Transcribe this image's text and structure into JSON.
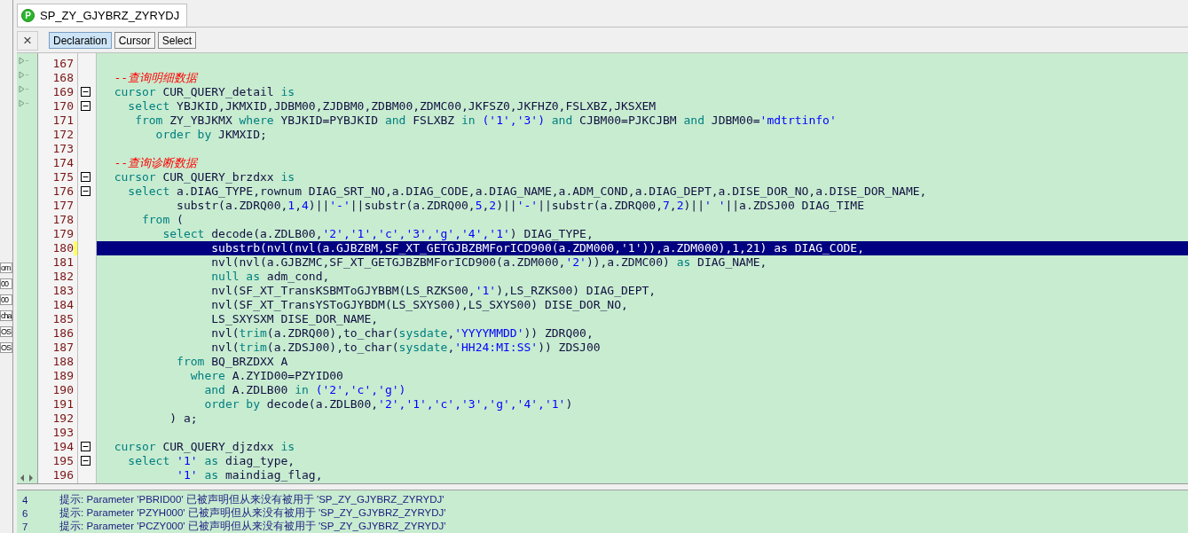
{
  "left_panel": {
    "items": [
      "om",
      "00",
      "00",
      "cha",
      "OS",
      "OS"
    ]
  },
  "tab": {
    "title": "SP_ZY_GJYBRZ_ZYRYDJ",
    "icon_letter": "P",
    "selected": true
  },
  "toolbar": {
    "close": "×",
    "buttons": [
      {
        "label": "Declaration",
        "selected": true
      },
      {
        "label": "Cursor",
        "selected": false
      },
      {
        "label": "Select",
        "selected": false
      }
    ]
  },
  "editor": {
    "lines": [
      {
        "number": "167",
        "fold": false,
        "selected": false
      },
      {
        "number": "168",
        "fold": false,
        "selected": false,
        "tokens": [
          {
            "kind": "comment",
            "text": "  --查询明细数据"
          }
        ]
      },
      {
        "number": "169",
        "fold": true,
        "selected": false,
        "tokens": [
          {
            "kind": "keyword",
            "text": "  cursor"
          },
          {
            "kind": "plain",
            "text": " CUR_QUERY_detail "
          },
          {
            "kind": "keyword",
            "text": "is"
          }
        ]
      },
      {
        "number": "170",
        "fold": true,
        "selected": false,
        "tokens": [
          {
            "kind": "keyword",
            "text": "    select"
          },
          {
            "kind": "plain",
            "text": " YBJKID,JKMXID,JDBM00,ZJDBM0,ZDBM00,ZDMC00,JKFSZ0,JKFHZ0,FSLXBZ,JKSXEM"
          }
        ]
      },
      {
        "number": "171",
        "fold": false,
        "selected": false,
        "tokens": [
          {
            "kind": "keyword",
            "text": "     from"
          },
          {
            "kind": "plain",
            "text": " ZY_YBJKMX "
          },
          {
            "kind": "keyword",
            "text": "where"
          },
          {
            "kind": "plain",
            "text": " YBJKID=PYBJKID "
          },
          {
            "kind": "keyword",
            "text": "and"
          },
          {
            "kind": "plain",
            "text": " FSLXBZ "
          },
          {
            "kind": "keyword",
            "text": "in"
          },
          {
            "kind": "string",
            "text": " ('1','3') "
          },
          {
            "kind": "keyword",
            "text": "and"
          },
          {
            "kind": "plain",
            "text": " CJBM00=PJKCJBM "
          },
          {
            "kind": "keyword",
            "text": "and"
          },
          {
            "kind": "plain",
            "text": " JDBM00="
          },
          {
            "kind": "string",
            "text": "'mdtrtinfo'"
          }
        ]
      },
      {
        "number": "172",
        "fold": false,
        "selected": false,
        "tokens": [
          {
            "kind": "keyword",
            "text": "        order by"
          },
          {
            "kind": "plain",
            "text": " JKMXID;"
          }
        ]
      },
      {
        "number": "173",
        "fold": false,
        "selected": false
      },
      {
        "number": "174",
        "fold": false,
        "selected": false,
        "tokens": [
          {
            "kind": "comment",
            "text": "  --查询诊断数据"
          }
        ]
      },
      {
        "number": "175",
        "fold": true,
        "selected": false,
        "tokens": [
          {
            "kind": "keyword",
            "text": "  cursor"
          },
          {
            "kind": "plain",
            "text": " CUR_QUERY_brzdxx "
          },
          {
            "kind": "keyword",
            "text": "is"
          }
        ]
      },
      {
        "number": "176",
        "fold": true,
        "selected": false,
        "tokens": [
          {
            "kind": "keyword",
            "text": "    select"
          },
          {
            "kind": "plain",
            "text": " a.DIAG_TYPE,rownum DIAG_SRT_NO,a.DIAG_CODE,a.DIAG_NAME,a.ADM_COND,a.DIAG_DEPT,a.DISE_DOR_NO,a.DISE_DOR_NAME,"
          }
        ]
      },
      {
        "number": "177",
        "fold": false,
        "selected": false,
        "tokens": [
          {
            "kind": "plain",
            "text": "           substr(a.ZDRQ00,"
          },
          {
            "kind": "string",
            "text": "1"
          },
          {
            "kind": "plain",
            "text": ","
          },
          {
            "kind": "string",
            "text": "4"
          },
          {
            "kind": "plain",
            "text": ")||"
          },
          {
            "kind": "string",
            "text": "'-'"
          },
          {
            "kind": "plain",
            "text": "||substr(a.ZDRQ00,"
          },
          {
            "kind": "string",
            "text": "5"
          },
          {
            "kind": "plain",
            "text": ","
          },
          {
            "kind": "string",
            "text": "2"
          },
          {
            "kind": "plain",
            "text": ")||"
          },
          {
            "kind": "string",
            "text": "'-'"
          },
          {
            "kind": "plain",
            "text": "||substr(a.ZDRQ00,"
          },
          {
            "kind": "string",
            "text": "7"
          },
          {
            "kind": "plain",
            "text": ","
          },
          {
            "kind": "string",
            "text": "2"
          },
          {
            "kind": "plain",
            "text": ")||"
          },
          {
            "kind": "string",
            "text": "' '"
          },
          {
            "kind": "plain",
            "text": "||a.ZDSJ00 DIAG_TIME"
          }
        ]
      },
      {
        "number": "178",
        "fold": false,
        "selected": false,
        "tokens": [
          {
            "kind": "keyword",
            "text": "      from"
          },
          {
            "kind": "plain",
            "text": " ("
          }
        ]
      },
      {
        "number": "179",
        "fold": false,
        "selected": false,
        "tokens": [
          {
            "kind": "keyword",
            "text": "         select"
          },
          {
            "kind": "plain",
            "text": " decode(a.ZDLB00,"
          },
          {
            "kind": "string",
            "text": "'2','1','c','3','g','4','1'"
          },
          {
            "kind": "plain",
            "text": ") DIAG_TYPE,"
          }
        ]
      },
      {
        "number": "180",
        "fold": false,
        "selected": true,
        "tokens": [
          {
            "kind": "plain",
            "text": "                substrb(nvl(nvl(a.GJBZBM,SF_XT_GETGJBZBMForICD900(a.ZDM000,"
          },
          {
            "kind": "string",
            "text": "'1'"
          },
          {
            "kind": "plain",
            "text": ")),a.ZDM000),"
          },
          {
            "kind": "string",
            "text": "1"
          },
          {
            "kind": "plain",
            "text": ","
          },
          {
            "kind": "string",
            "text": "21"
          },
          {
            "kind": "plain",
            "text": ") "
          },
          {
            "kind": "keyword",
            "text": "as"
          },
          {
            "kind": "plain",
            "text": " DIAG_CODE,"
          }
        ]
      },
      {
        "number": "181",
        "fold": false,
        "selected": false,
        "tokens": [
          {
            "kind": "plain",
            "text": "                nvl(nvl(a.GJBZMC,SF_XT_GETGJBZBMForICD900(a.ZDM000,"
          },
          {
            "kind": "string",
            "text": "'2'"
          },
          {
            "kind": "plain",
            "text": ")),a.ZDMC00) "
          },
          {
            "kind": "keyword",
            "text": "as"
          },
          {
            "kind": "plain",
            "text": " DIAG_NAME,"
          }
        ]
      },
      {
        "number": "182",
        "fold": false,
        "selected": false,
        "tokens": [
          {
            "kind": "keyword",
            "text": "                null as"
          },
          {
            "kind": "plain",
            "text": " adm_cond,"
          }
        ]
      },
      {
        "number": "183",
        "fold": false,
        "selected": false,
        "tokens": [
          {
            "kind": "plain",
            "text": "                nvl(SF_XT_TransKSBMToGJYBBM(LS_RZKS00,"
          },
          {
            "kind": "string",
            "text": "'1'"
          },
          {
            "kind": "plain",
            "text": "),LS_RZKS00) DIAG_DEPT,"
          }
        ]
      },
      {
        "number": "184",
        "fold": false,
        "selected": false,
        "tokens": [
          {
            "kind": "plain",
            "text": "                nvl(SF_XT_TransYSToGJYBDM(LS_SXYS00),LS_SXYS00) DISE_DOR_NO,"
          }
        ]
      },
      {
        "number": "185",
        "fold": false,
        "selected": false,
        "tokens": [
          {
            "kind": "plain",
            "text": "                LS_SXYSXM DISE_DOR_NAME,"
          }
        ]
      },
      {
        "number": "186",
        "fold": false,
        "selected": false,
        "tokens": [
          {
            "kind": "plain",
            "text": "                nvl("
          },
          {
            "kind": "keyword",
            "text": "trim"
          },
          {
            "kind": "plain",
            "text": "(a.ZDRQ00),to_char("
          },
          {
            "kind": "keyword",
            "text": "sysdate"
          },
          {
            "kind": "plain",
            "text": ","
          },
          {
            "kind": "string",
            "text": "'YYYYMMDD'"
          },
          {
            "kind": "plain",
            "text": ")) ZDRQ00,"
          }
        ]
      },
      {
        "number": "187",
        "fold": false,
        "selected": false,
        "tokens": [
          {
            "kind": "plain",
            "text": "                nvl("
          },
          {
            "kind": "keyword",
            "text": "trim"
          },
          {
            "kind": "plain",
            "text": "(a.ZDSJ00),to_char("
          },
          {
            "kind": "keyword",
            "text": "sysdate"
          },
          {
            "kind": "plain",
            "text": ","
          },
          {
            "kind": "string",
            "text": "'HH24:MI:SS'"
          },
          {
            "kind": "plain",
            "text": ")) ZDSJ00"
          }
        ]
      },
      {
        "number": "188",
        "fold": false,
        "selected": false,
        "tokens": [
          {
            "kind": "keyword",
            "text": "           from"
          },
          {
            "kind": "plain",
            "text": " BQ_BRZDXX A"
          }
        ]
      },
      {
        "number": "189",
        "fold": false,
        "selected": false,
        "tokens": [
          {
            "kind": "keyword",
            "text": "             where"
          },
          {
            "kind": "plain",
            "text": " A.ZYID00=PZYID00"
          }
        ]
      },
      {
        "number": "190",
        "fold": false,
        "selected": false,
        "tokens": [
          {
            "kind": "keyword",
            "text": "               and"
          },
          {
            "kind": "plain",
            "text": " A.ZDLB00 "
          },
          {
            "kind": "keyword",
            "text": "in"
          },
          {
            "kind": "string",
            "text": " ('2','c','g')"
          }
        ]
      },
      {
        "number": "191",
        "fold": false,
        "selected": false,
        "tokens": [
          {
            "kind": "keyword",
            "text": "               order by"
          },
          {
            "kind": "plain",
            "text": " decode(a.ZDLB00,"
          },
          {
            "kind": "string",
            "text": "'2','1','c','3','g','4','1'"
          },
          {
            "kind": "plain",
            "text": ")"
          }
        ]
      },
      {
        "number": "192",
        "fold": false,
        "selected": false,
        "tokens": [
          {
            "kind": "plain",
            "text": "          ) a;"
          }
        ]
      },
      {
        "number": "193",
        "fold": false,
        "selected": false
      },
      {
        "number": "194",
        "fold": true,
        "selected": false,
        "tokens": [
          {
            "kind": "keyword",
            "text": "  cursor"
          },
          {
            "kind": "plain",
            "text": " CUR_QUERY_djzdxx "
          },
          {
            "kind": "keyword",
            "text": "is"
          }
        ]
      },
      {
        "number": "195",
        "fold": true,
        "selected": false,
        "tokens": [
          {
            "kind": "keyword",
            "text": "    select"
          },
          {
            "kind": "string",
            "text": " '1' "
          },
          {
            "kind": "keyword",
            "text": "as"
          },
          {
            "kind": "plain",
            "text": " diag_type,"
          }
        ]
      },
      {
        "number": "196",
        "fold": false,
        "selected": false,
        "tokens": [
          {
            "kind": "string",
            "text": "           '1' "
          },
          {
            "kind": "keyword",
            "text": "as"
          },
          {
            "kind": "plain",
            "text": " maindiag_flag,"
          }
        ]
      }
    ]
  },
  "messages": [
    {
      "line": "4",
      "text": "提示: Parameter 'PBRID00' 已被声明但从来没有被用于 'SP_ZY_GJYBRZ_ZYRYDJ'"
    },
    {
      "line": "6",
      "text": "提示: Parameter 'PZYH000' 已被声明但从来没有被用于 'SP_ZY_GJYBRZ_ZYRYDJ'"
    },
    {
      "line": "7",
      "text": "提示: Parameter 'PCZY000' 已被声明但从来没有被用于 'SP_ZY_GJYBRZ_ZYRYDJ'"
    }
  ]
}
